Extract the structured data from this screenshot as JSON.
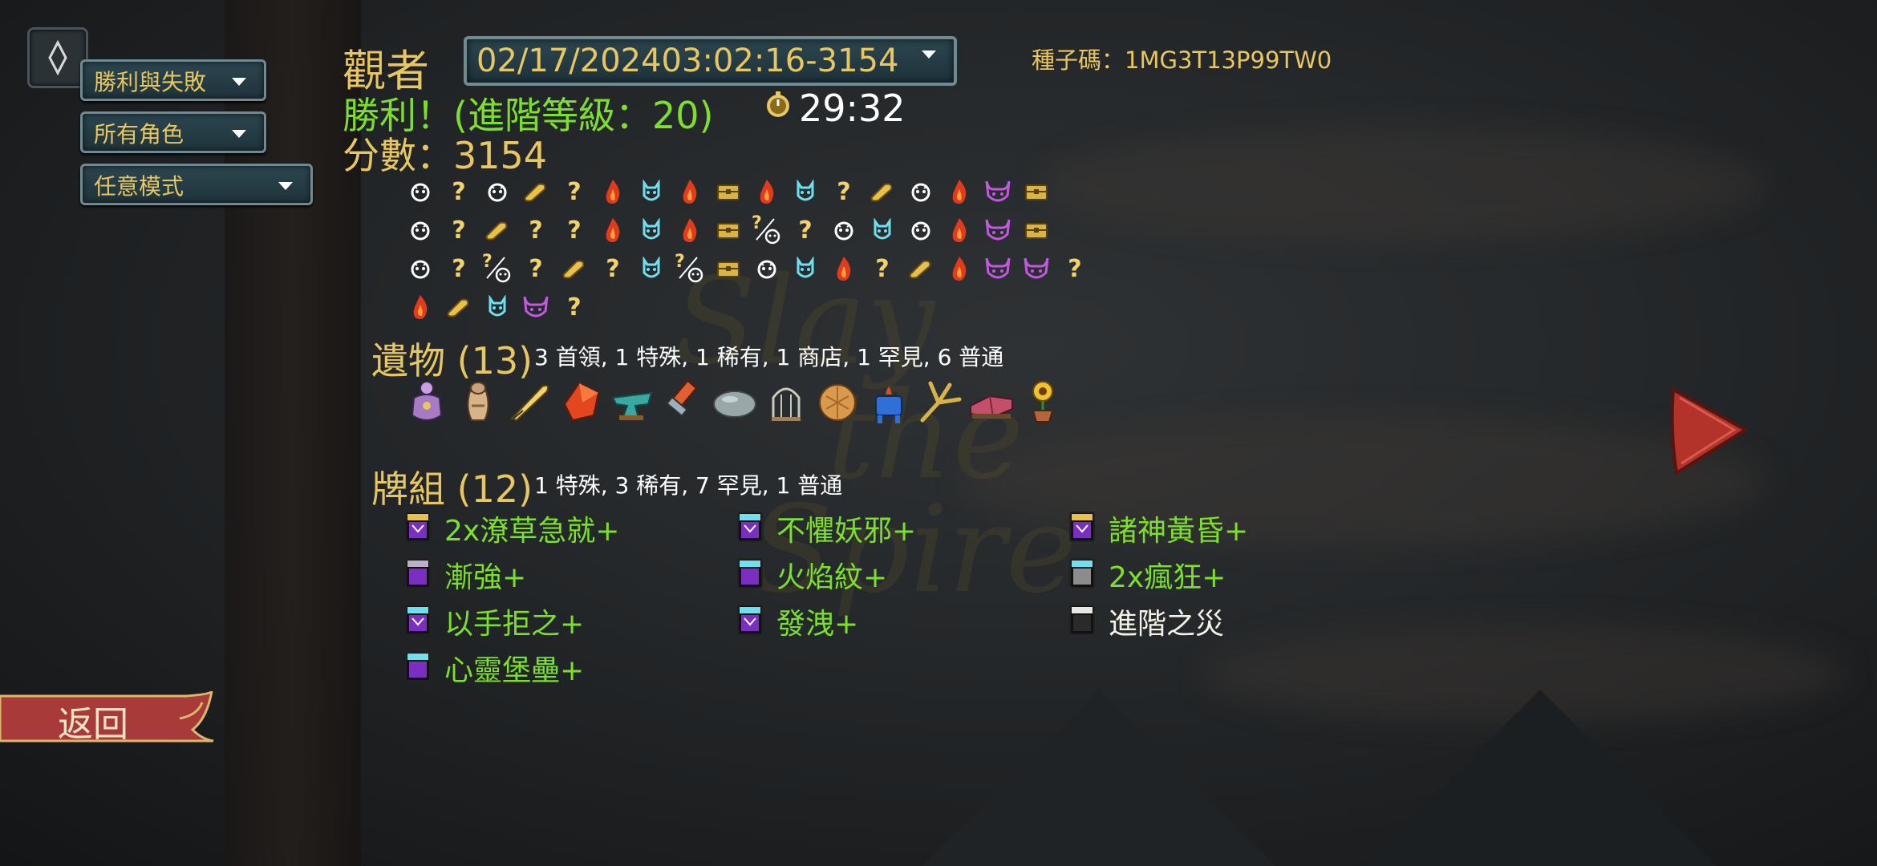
{
  "filters": {
    "result": "勝利與失敗",
    "character": "所有角色",
    "mode": "任意模式"
  },
  "header": {
    "title": "觀者",
    "run": "02/17/202403:02:16-3154",
    "seed": "種子碼：1MG3T13P99TW0",
    "victory": "勝利！(進階等級：20)",
    "time": "29:32",
    "score": "分數：3154"
  },
  "path": [
    [
      "monster",
      "unknown",
      "monster",
      "treasure-gold",
      "unknown",
      "rest",
      "elite-cyan",
      "rest",
      "chest",
      "rest",
      "elite-cyan",
      "unknown",
      "treasure-gold",
      "monster",
      "rest",
      "boss",
      "chest"
    ],
    [
      "monster",
      "unknown",
      "treasure-gold",
      "unknown",
      "unknown",
      "rest",
      "elite-cyan",
      "rest",
      "chest",
      "unknown-monster",
      "unknown",
      "monster",
      "elite-cyan",
      "monster",
      "rest",
      "boss",
      "chest"
    ],
    [
      "monster",
      "unknown",
      "unknown-monster",
      "unknown",
      "treasure-gold",
      "unknown",
      "elite-cyan",
      "unknown-monster",
      "chest",
      "monster",
      "elite-cyan",
      "rest",
      "unknown",
      "treasure-gold",
      "rest",
      "boss",
      "boss",
      "unknown"
    ],
    [
      "rest",
      "treasure-gold",
      "elite-cyan",
      "boss",
      "unknown"
    ]
  ],
  "relics": {
    "title": "遺物 (13)",
    "summary": "3 首領, 1 特殊, 1 稀有, 1 商店, 1 罕見, 6 普通",
    "items": [
      "lantern-pot",
      "vase",
      "quill",
      "red-gem",
      "anvil",
      "hammer",
      "stone",
      "birdcage",
      "cookie",
      "blue-kettle",
      "claw",
      "cushion",
      "sunflower"
    ]
  },
  "deck": {
    "title": "牌組 (12)",
    "summary": "1 特殊, 3 稀有, 7 罕見, 1 普通",
    "columns": [
      [
        {
          "name": "2x潦草急就+",
          "icon": "skill-gold"
        },
        {
          "name": "漸強+",
          "icon": "power-gray"
        },
        {
          "name": "以手拒之+",
          "icon": "skill-cyan"
        },
        {
          "name": "心靈堡壘+",
          "icon": "power-cyan"
        }
      ],
      [
        {
          "name": "不懼妖邪+",
          "icon": "skill-cyan"
        },
        {
          "name": "火焰紋+",
          "icon": "power-cyan"
        },
        {
          "name": "發洩+",
          "icon": "skill-cyan"
        }
      ],
      [
        {
          "name": "諸神黃昏+",
          "icon": "skill-gold"
        },
        {
          "name": "2x瘋狂+",
          "icon": "colorless-cyan"
        },
        {
          "name": "進階之災",
          "icon": "curse"
        }
      ]
    ]
  },
  "back": "返回",
  "colors": {
    "gold": "#e8c660",
    "green": "#7ce02a",
    "cyan": "#6fe0f0",
    "purple": "#c259e0"
  }
}
